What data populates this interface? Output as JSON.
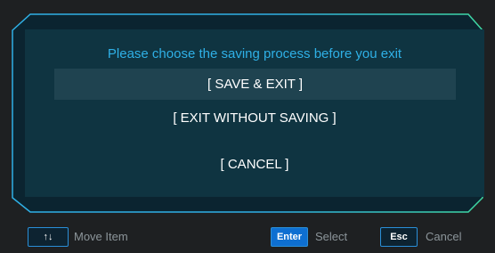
{
  "dialog": {
    "title": "Please choose the saving process before you exit",
    "options": [
      {
        "label": "[ SAVE & EXIT ]",
        "selected": true
      },
      {
        "label": "[ EXIT WITHOUT SAVING ]",
        "selected": false
      },
      {
        "label": "[ CANCEL ]",
        "selected": false
      }
    ]
  },
  "footer": {
    "move_key": "↑↓",
    "move_label": "Move Item",
    "select_key": "Enter",
    "select_label": "Select",
    "cancel_key": "Esc",
    "cancel_label": "Cancel"
  },
  "colors": {
    "accent_cyan": "#2fb0e6",
    "accent_green": "#3fd9a3",
    "panel": "#0f3441",
    "selection": "#1f4350"
  }
}
